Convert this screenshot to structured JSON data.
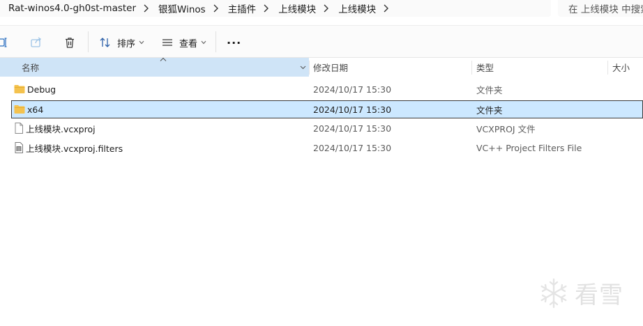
{
  "address_bar": {
    "crumbs": [
      "Rat-winos4.0-gh0st-master",
      "银狐Winos",
      "主插件",
      "上线模块",
      "上线模块"
    ],
    "search_placeholder": "在 上线模块 中搜索"
  },
  "command_bar": {
    "sort_label": "排序",
    "view_label": "查看",
    "more_label": "···"
  },
  "columns": {
    "name": "名称",
    "date": "修改日期",
    "type": "类型",
    "size": "大小"
  },
  "files": [
    {
      "name": "Debug",
      "date": "2024/10/17 15:30",
      "type": "文件夹",
      "icon": "folder-icon",
      "selected": false
    },
    {
      "name": "x64",
      "date": "2024/10/17 15:30",
      "type": "文件夹",
      "icon": "folder-icon",
      "selected": true
    },
    {
      "name": "上线模块.vcxproj",
      "date": "2024/10/17 15:30",
      "type": "VCXPROJ 文件",
      "icon": "file-icon",
      "selected": false
    },
    {
      "name": "上线模块.vcxproj.filters",
      "date": "2024/10/17 15:30",
      "type": "VC++ Project Filters File",
      "icon": "filters-file-icon",
      "selected": false
    }
  ],
  "watermark": {
    "text": "看雪"
  },
  "colors": {
    "selection": "#cce8ff",
    "header_sorted": "#cfe4f7",
    "folder": "#f4c24e"
  }
}
